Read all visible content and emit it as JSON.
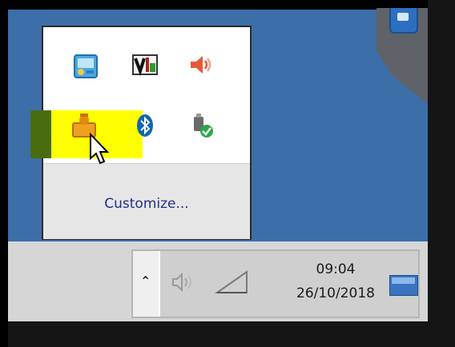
{
  "tray_popup": {
    "customize_label": "Customize...",
    "icons": [
      {
        "name": "network-monitor-icon"
      },
      {
        "name": "vmware-icon"
      },
      {
        "name": "speaker-icon"
      },
      {
        "name": "user-folder-icon"
      },
      {
        "name": "bluetooth-icon"
      },
      {
        "name": "usb-device-icon"
      }
    ]
  },
  "taskbar": {
    "time": "09:04",
    "date": "26/10/2018",
    "chevron_label": "⌃"
  },
  "colors": {
    "desktop": "#3c6ea8",
    "highlight": "#ffff00",
    "link": "#1f2f8f"
  }
}
